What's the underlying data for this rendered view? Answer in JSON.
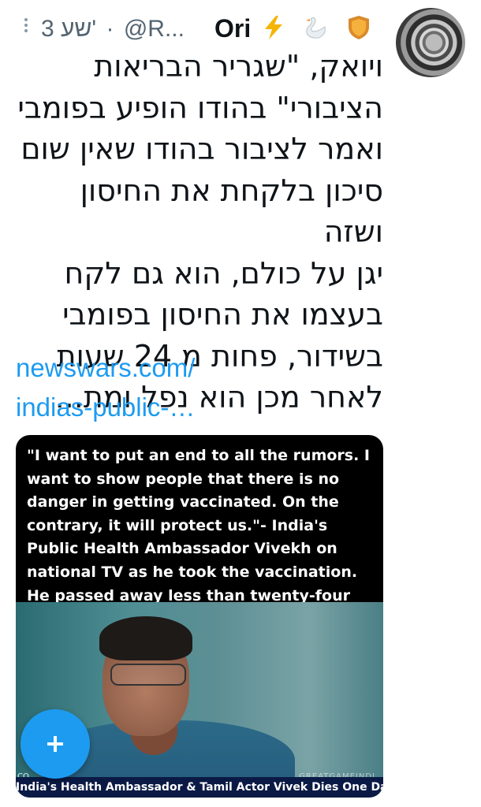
{
  "tweet": {
    "author_name": "Ori",
    "author_emojis": [
      "lightning-emoji",
      "swan-emoji",
      "shield-emoji"
    ],
    "handle_truncated": "@R...",
    "separator": "·",
    "timestamp": "3 שע'",
    "body_lines": [
      "ויואק, \"שגריר הבריאות",
      "הציבורי\" בהודו הופיע בפומבי",
      "ואמר לציבור בהודו שאין שום",
      "סיכון בלקחת את החיסון ושזה",
      "יגן על כולם, הוא גם לקח",
      "בעצמו את החיסון בפומבי",
      "בשידור, פחות מ 24 שעות",
      "לאחר מכן הוא נפל ומת..."
    ],
    "link_line1": "newswars.com/",
    "link_line2": "indias-public-…",
    "media": {
      "quote_text": "\"I want to put an end to all the rumors. I want to show people that there is no danger in getting vaccinated. On the contrary, it will protect us.\"- India's Public Health Ambassador Vivekh on national TV as he took the vaccination. He passed away less than twenty-four hours later.",
      "watermark": "GREATGAMEINDI",
      "channel_tag": "CO",
      "caption": "India's Health Ambassador & Tamil Actor Vivek Dies One Day"
    }
  },
  "fab": {
    "icon": "plus-icon"
  },
  "colors": {
    "link": "#1d9bf0",
    "fab": "#1d9bf0",
    "meta": "#536471"
  }
}
